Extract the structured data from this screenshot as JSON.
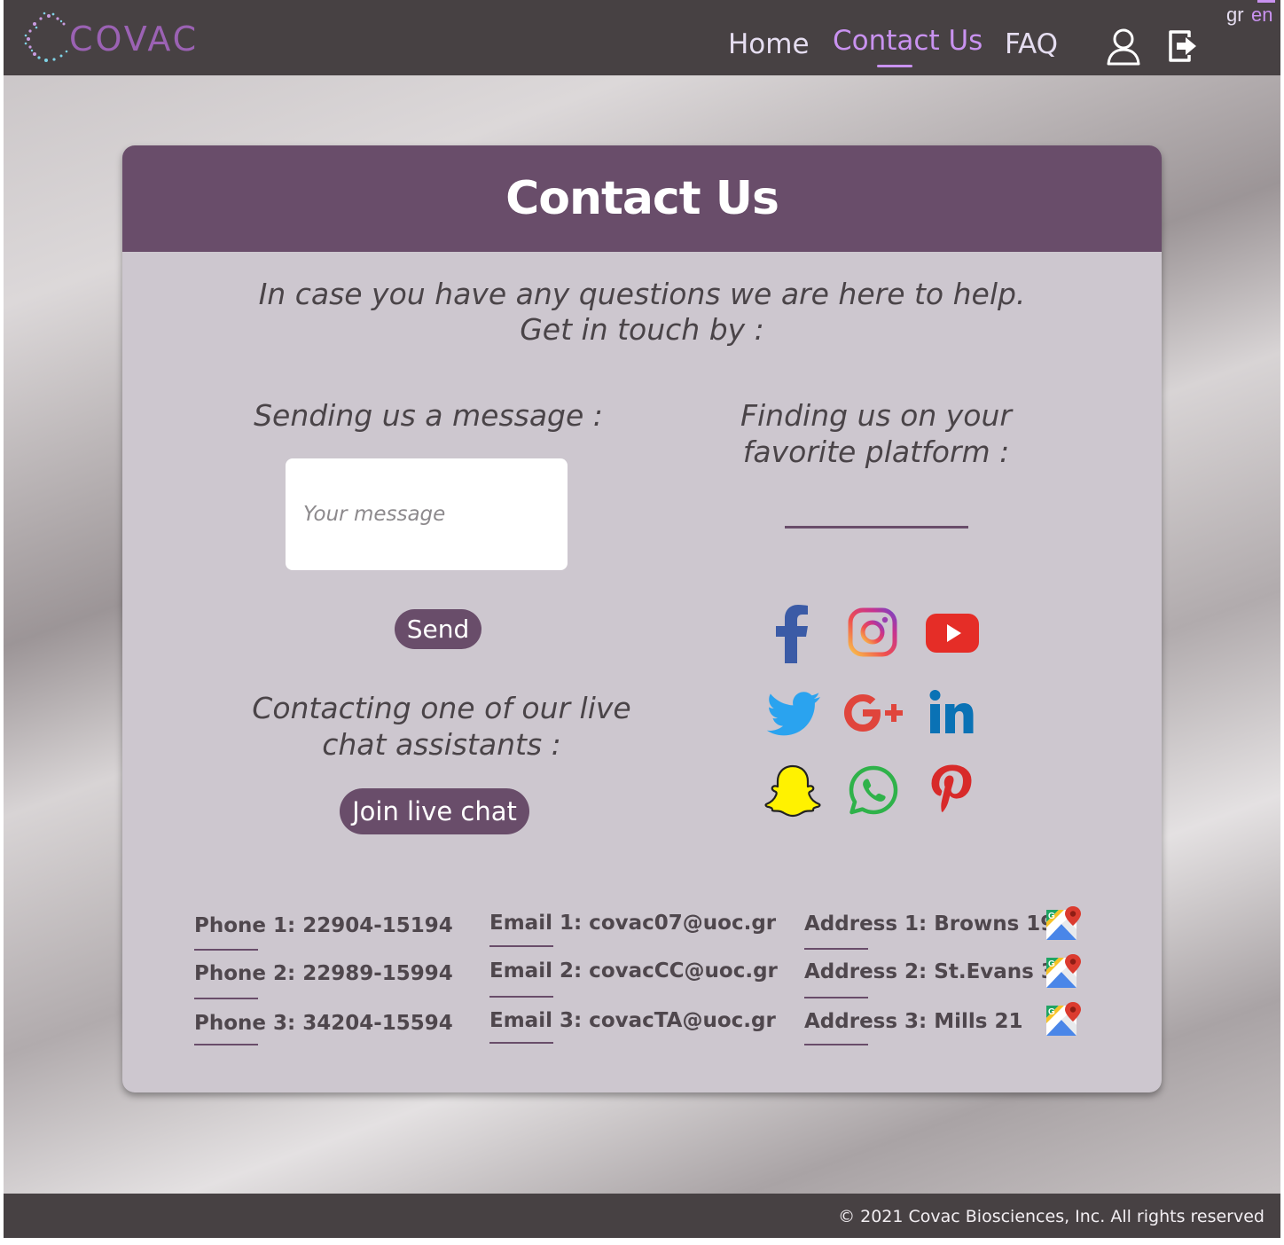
{
  "header": {
    "logo_text": "COVAC",
    "nav": {
      "home": "Home",
      "contact": "Contact Us",
      "faq": "FAQ"
    },
    "lang": {
      "gr": "gr",
      "en": "en"
    },
    "icons": [
      "user-icon",
      "logout-icon"
    ]
  },
  "card": {
    "title": "Contact Us",
    "intro_line1": "In case you have any questions we are here to help.",
    "intro_line2": "Get in touch by :",
    "send_heading": "Sending us a message :",
    "message_placeholder": "Your message",
    "send_label": "Send",
    "livechat_heading_line1": "Contacting one of our live",
    "livechat_heading_line2": "chat assistants :",
    "livechat_label": "Join live chat",
    "platform_heading_line1": "Finding us on your",
    "platform_heading_line2": "favorite platform :",
    "socials": [
      "facebook-icon",
      "instagram-icon",
      "youtube-icon",
      "twitter-icon",
      "google-plus-icon",
      "linkedin-icon",
      "snapchat-icon",
      "whatsapp-icon",
      "pinterest-icon"
    ]
  },
  "contacts": {
    "phones": [
      "Phone 1: 22904-15194",
      "Phone 2: 22989-15994",
      "Phone 3: 34204-15594"
    ],
    "emails": [
      "Email 1: covac07@uoc.gr",
      "Email 2: covacCC@uoc.gr",
      "Email 3: covacTA@uoc.gr"
    ],
    "addresses": [
      "Address 1: Browns 19",
      "Address 2: St.Evans 32",
      "Address 3: Mills 21"
    ]
  },
  "footer": {
    "copyright": "© 2021 Covac Biosciences, Inc. All rights reserved"
  },
  "colors": {
    "header_bg": "#474143",
    "accent": "#694d6a",
    "nav_active": "#c992f0",
    "card_bg": "#cdc7cf"
  }
}
